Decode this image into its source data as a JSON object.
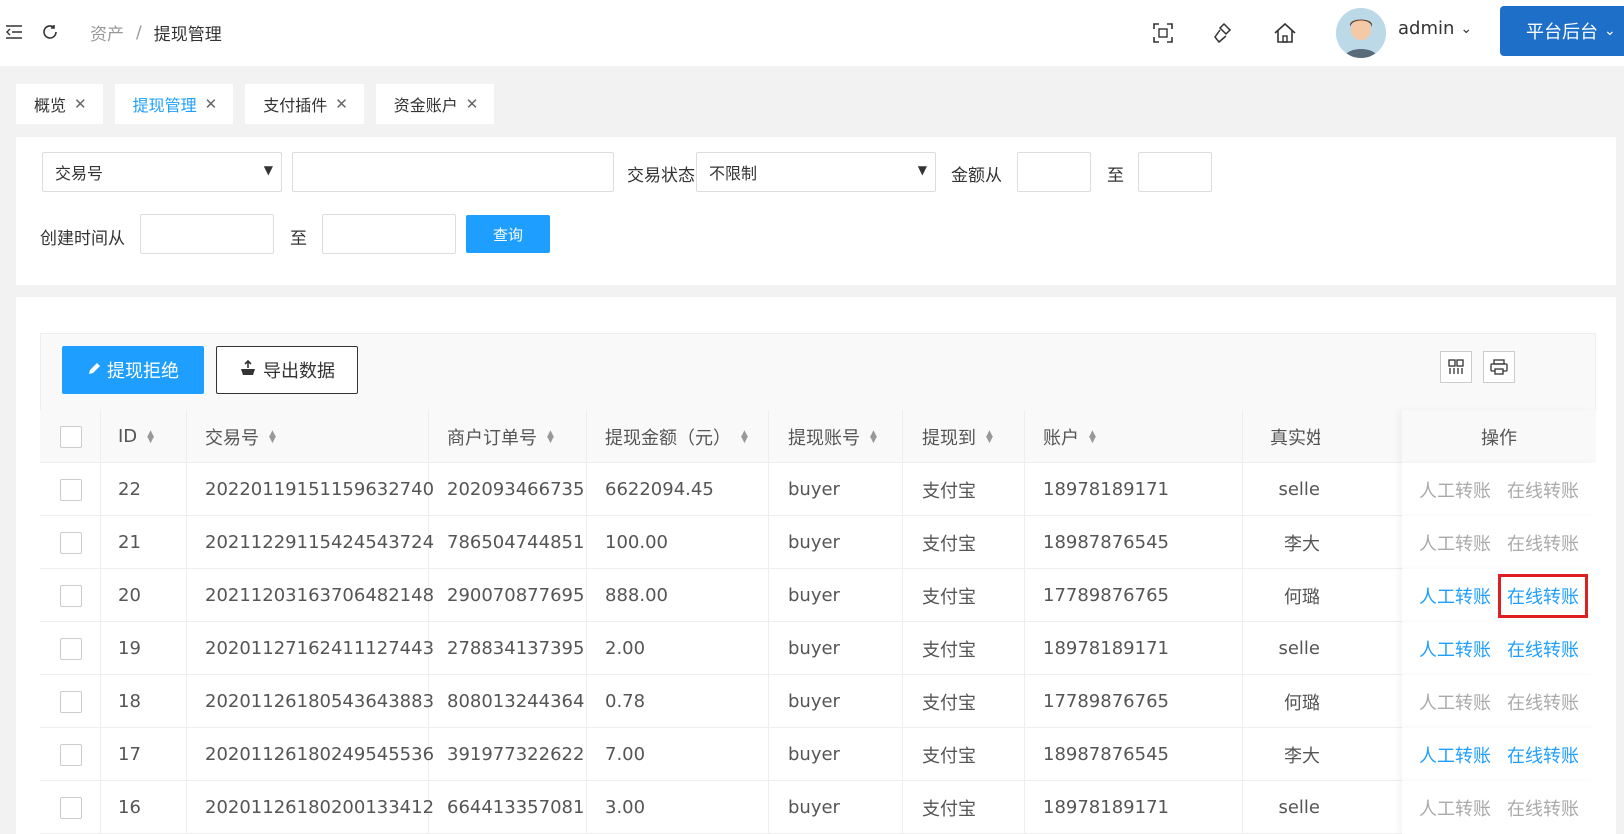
{
  "header": {
    "breadcrumb": [
      "资产",
      "提现管理"
    ],
    "breadcrumb_sep": "/",
    "user": "admin",
    "platform_button": "平台后台"
  },
  "tabs": [
    {
      "label": "概览",
      "active": false
    },
    {
      "label": "提现管理",
      "active": true
    },
    {
      "label": "支付插件",
      "active": false
    },
    {
      "label": "资金账户",
      "active": false
    }
  ],
  "filters": {
    "field_select": "交易号",
    "status_label": "交易状态",
    "status_value": "不限制",
    "amount_from_label": "金额从",
    "to_label": "至",
    "created_from_label": "创建时间从",
    "query_button": "查询"
  },
  "toolbar": {
    "reject_button": "提现拒绝",
    "export_button": "导出数据"
  },
  "table": {
    "columns": [
      "ID",
      "交易号",
      "商户订单号",
      "提现金额（元）",
      "提现账号",
      "提现到",
      "账户",
      "真实姓",
      "操作"
    ],
    "rows": [
      {
        "id": "22",
        "trade_no": "20220119151159632740",
        "order_no": "202093466735",
        "amount": "6622094.45",
        "account_name": "buyer",
        "to": "支付宝",
        "account": "18978189171",
        "real_name": "selle",
        "op1": "人工转账",
        "op2": "在线转账",
        "op1_on": false,
        "op2_on": false
      },
      {
        "id": "21",
        "trade_no": "20211229115424543724",
        "order_no": "786504744851",
        "amount": "100.00",
        "account_name": "buyer",
        "to": "支付宝",
        "account": "18987876545",
        "real_name": "李大",
        "op1": "人工转账",
        "op2": "在线转账",
        "op1_on": false,
        "op2_on": false
      },
      {
        "id": "20",
        "trade_no": "20211203163706482148",
        "order_no": "290070877695",
        "amount": "888.00",
        "account_name": "buyer",
        "to": "支付宝",
        "account": "17789876765",
        "real_name": "何璐",
        "op1": "人工转账",
        "op2": "在线转账",
        "op1_on": true,
        "op2_on": true
      },
      {
        "id": "19",
        "trade_no": "20201127162411127443",
        "order_no": "278834137395",
        "amount": "2.00",
        "account_name": "buyer",
        "to": "支付宝",
        "account": "18978189171",
        "real_name": "selle",
        "op1": "人工转账",
        "op2": "在线转账",
        "op1_on": true,
        "op2_on": true
      },
      {
        "id": "18",
        "trade_no": "20201126180543643883",
        "order_no": "808013244364",
        "amount": "0.78",
        "account_name": "buyer",
        "to": "支付宝",
        "account": "17789876765",
        "real_name": "何璐",
        "op1": "人工转账",
        "op2": "在线转账",
        "op1_on": false,
        "op2_on": false
      },
      {
        "id": "17",
        "trade_no": "20201126180249545536",
        "order_no": "391977322622",
        "amount": "7.00",
        "account_name": "buyer",
        "to": "支付宝",
        "account": "18987876545",
        "real_name": "李大",
        "op1": "人工转账",
        "op2": "在线转账",
        "op1_on": true,
        "op2_on": true
      },
      {
        "id": "16",
        "trade_no": "20201126180200133412",
        "order_no": "664413357081",
        "amount": "3.00",
        "account_name": "buyer",
        "to": "支付宝",
        "account": "18978189171",
        "real_name": "selle",
        "op1": "人工转账",
        "op2": "在线转账",
        "op1_on": false,
        "op2_on": false
      }
    ]
  },
  "colors": {
    "accent": "#1e9fff",
    "brand": "#1e6fc7",
    "highlight": "#e02020"
  }
}
